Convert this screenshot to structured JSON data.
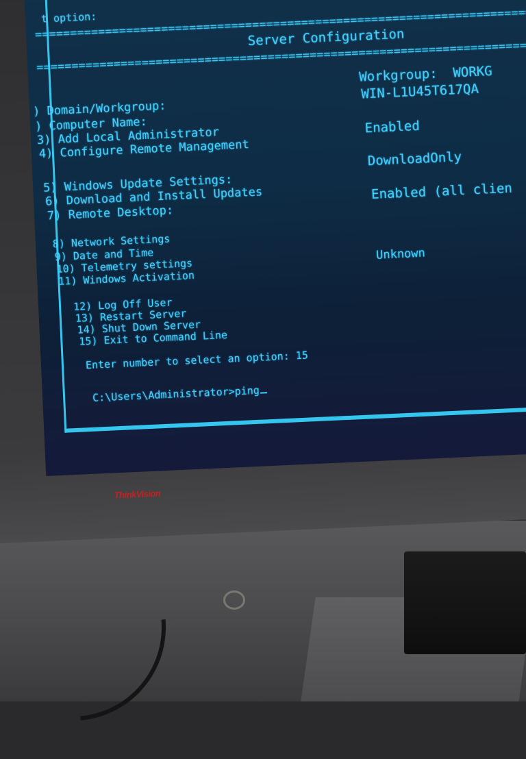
{
  "console": {
    "prev_prompt": "t option:",
    "separator": "===============================================================================",
    "title": "Server Configuration",
    "menu": [
      {
        "label": ") Domain/Workgroup:"
      },
      {
        "label": ") Computer Name:"
      },
      {
        "label": "3) Add Local Administrator"
      },
      {
        "label": "4) Configure Remote Management"
      },
      {
        "label": "5) Windows Update Settings:"
      },
      {
        "label": "6) Download and Install Updates"
      },
      {
        "label": "7) Remote Desktop:"
      },
      {
        "label": "8) Network Settings"
      },
      {
        "label": "9) Date and Time"
      },
      {
        "label": "10) Telemetry settings"
      },
      {
        "label": "11) Windows Activation"
      },
      {
        "label": "12) Log Off User"
      },
      {
        "label": "13) Restart Server"
      },
      {
        "label": "14) Shut Down Server"
      },
      {
        "label": "15) Exit to Command Line"
      }
    ],
    "values": {
      "workgroup": "Workgroup:  WORKG",
      "computer_name": "WIN-L1U45T617QA",
      "remote_management": "Enabled",
      "windows_update": "DownloadOnly",
      "remote_desktop": "Enabled (all clien",
      "telemetry": "Unknown"
    },
    "select_prompt": "Enter number to select an option: 15",
    "command_line": "C:\\Users\\Administrator>ping"
  },
  "monitor": {
    "brand": "ThinkVision"
  },
  "colors": {
    "terminal_text": "#3fd0ff",
    "terminal_bg": "#0e2c45",
    "brand_red": "#c32222"
  }
}
